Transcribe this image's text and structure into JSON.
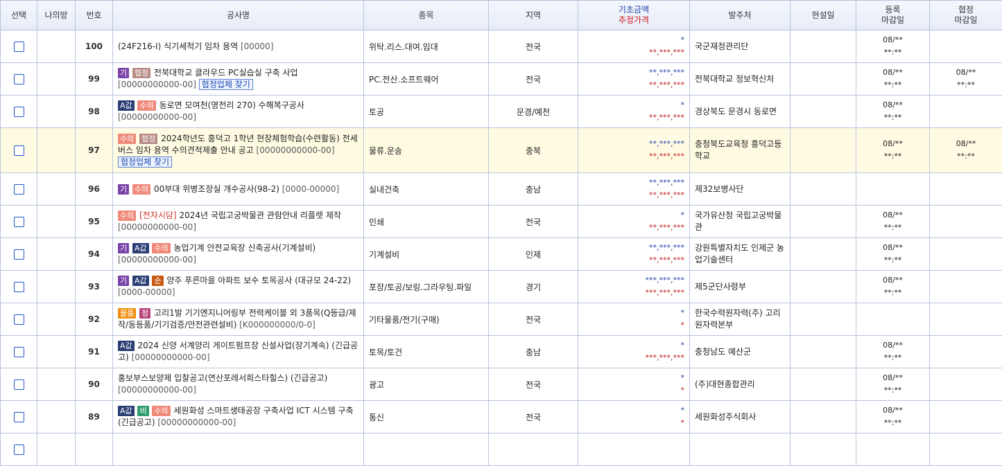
{
  "header": {
    "select": "선택",
    "mine": "나의방",
    "no": "번호",
    "title": "공사명",
    "category": "종목",
    "region": "지역",
    "price_l1": "기초금액",
    "price_l2": "추정가격",
    "owner": "발주처",
    "site_date": "현설일",
    "reg_l1": "등록",
    "reg_l2": "마감일",
    "coop_l1": "협정",
    "coop_l2": "마감일"
  },
  "rows": [
    {
      "no": "100",
      "tags": [],
      "text": "(24F216-I) 식기세척기 임차 용역",
      "code": "[00000]",
      "find": "",
      "category": "위탁.리스.대여.임대",
      "region": "전국",
      "base": "*",
      "est": "**,***,***",
      "owner": "국군재정관리단",
      "site": "",
      "reg1": "08/**",
      "reg2": "**:**",
      "coop1": "",
      "coop2": ""
    },
    {
      "no": "99",
      "tags": [
        {
          "t": "기",
          "c": "tag-gi"
        },
        {
          "t": "협정",
          "c": "tag-hj"
        }
      ],
      "text": "전북대학교 클라우드 PC실습실 구축 사업",
      "code": "[00000000000-00]",
      "find": "협정업체 찾기",
      "category": "PC.전산.소프트웨어",
      "region": "전국",
      "base": "**,***,***",
      "est": "**,***,***",
      "owner": "전북대학교 정보혁신처",
      "site": "",
      "reg1": "08/**",
      "reg2": "**:**",
      "coop1": "08/**",
      "coop2": "**:**"
    },
    {
      "no": "98",
      "tags": [
        {
          "t": "A값",
          "c": "tag-a"
        },
        {
          "t": "수의",
          "c": "tag-sui"
        }
      ],
      "text": "동로면 모여천(명전리 270) 수해복구공사",
      "code": "[00000000000-00]",
      "find": "",
      "category": "토공",
      "region": "문경/예천",
      "base": "*",
      "est": "**,***,***",
      "owner": "경상북도 문경시 동로면",
      "site": "",
      "reg1": "08/**",
      "reg2": "**:**",
      "coop1": "",
      "coop2": ""
    },
    {
      "no": "97",
      "tags": [
        {
          "t": "수의",
          "c": "tag-sui"
        },
        {
          "t": "협정",
          "c": "tag-hj"
        }
      ],
      "text": "2024학년도 흥덕고 1학년 현장체험학습(수련활동) 전세버스 임차 용역 수의견적제출 안내 공고",
      "code": "[00000000000-00]",
      "find": "협정업체 찾기",
      "category": "물류.운송",
      "region": "충북",
      "base": "**,***,***",
      "est": "**,***,***",
      "owner": "충청북도교육청 흥덕고등학교",
      "site": "",
      "reg1": "08/**",
      "reg2": "**:**",
      "coop1": "08/**",
      "coop2": "**:**"
    },
    {
      "no": "96",
      "tags": [
        {
          "t": "기",
          "c": "tag-gi"
        },
        {
          "t": "수의",
          "c": "tag-sui"
        }
      ],
      "text": "00부대 위병조장실 개수공사(98-2)",
      "code": "[0000-00000]",
      "find": "",
      "category": "실내건축",
      "region": "충남",
      "base": "**,***,***",
      "est": "**,***,***",
      "owner": "제32보병사단",
      "site": "",
      "reg1": "",
      "reg2": "",
      "coop1": "",
      "coop2": ""
    },
    {
      "no": "95",
      "tags": [
        {
          "t": "수의",
          "c": "tag-sui"
        }
      ],
      "etag": "[전자시담]",
      "text": "2024년 국립고궁박물관 관람안내 리플렛 제작",
      "code": "[00000000000-00]",
      "find": "",
      "category": "인쇄",
      "region": "전국",
      "base": "*",
      "est": "**,***,***",
      "owner": "국가유산청 국립고궁박물관",
      "site": "",
      "reg1": "08/**",
      "reg2": "**:**",
      "coop1": "",
      "coop2": ""
    },
    {
      "no": "94",
      "tags": [
        {
          "t": "기",
          "c": "tag-gi"
        },
        {
          "t": "A값",
          "c": "tag-a"
        },
        {
          "t": "수의",
          "c": "tag-sui"
        }
      ],
      "text": "농업기계 안전교육장 신축공사(기계설비)",
      "code": "[00000000000-00]",
      "find": "",
      "category": "기계설비",
      "region": "인제",
      "base": "**,***,***",
      "est": "**,***,***",
      "owner": "강원특별자치도 인제군 농업기술센터",
      "site": "",
      "reg1": "08/**",
      "reg2": "**:**",
      "coop1": "",
      "coop2": ""
    },
    {
      "no": "93",
      "tags": [
        {
          "t": "기",
          "c": "tag-gi"
        },
        {
          "t": "A값",
          "c": "tag-a"
        },
        {
          "t": "순",
          "c": "tag-sun"
        }
      ],
      "text": "양주 푸른마을 아파트 보수 토목공사 (대규모 24-22)",
      "code": "[0000-00000]",
      "find": "",
      "category": "포장/토공/보링.그라우팅.파일",
      "region": "경기",
      "base": "***,***,***",
      "est": "***,***,***",
      "owner": "제5군단사령부",
      "site": "",
      "reg1": "08/**",
      "reg2": "**:**",
      "coop1": "",
      "coop2": ""
    },
    {
      "no": "92",
      "tags": [
        {
          "t": "물품",
          "c": "tag-mul"
        },
        {
          "t": "정",
          "c": "tag-jeong"
        }
      ],
      "text": "고리1발 기기엔지니어링부 전력케이블 외 3품목(Q등급/제작/동등품/기기검증/안전관련설비)",
      "code": "[K000000000/0-0]",
      "find": "",
      "category": "기타물품/전기(구매)",
      "region": "전국",
      "base": "*",
      "est": "*",
      "owner": "한국수력원자력(주) 고리원자력본부",
      "site": "",
      "reg1": "",
      "reg2": "",
      "coop1": "",
      "coop2": ""
    },
    {
      "no": "91",
      "tags": [
        {
          "t": "A값",
          "c": "tag-a"
        }
      ],
      "text": "2024 신양 서계양리 게이트펌프장 신설사업(장기계속) (긴급공고)",
      "code": "[00000000000-00]",
      "find": "",
      "category": "토목/토건",
      "region": "충남",
      "base": "*",
      "est": "***,***,***",
      "owner": "충청남도 예산군",
      "site": "",
      "reg1": "08/**",
      "reg2": "**:**",
      "coop1": "",
      "coop2": ""
    },
    {
      "no": "90",
      "tags": [],
      "text": "홍보부스보양제 입찰공고(연산포레서희스타힐스) (긴급공고)",
      "code": "[00000000000-00]",
      "find": "",
      "category": "광고",
      "region": "전국",
      "base": "*",
      "est": "*",
      "owner": "(주)대현종합관리",
      "site": "",
      "reg1": "08/**",
      "reg2": "**:**",
      "coop1": "",
      "coop2": ""
    },
    {
      "no": "89",
      "tags": [
        {
          "t": "A값",
          "c": "tag-a"
        },
        {
          "t": "비",
          "c": "tag-bi"
        },
        {
          "t": "수의",
          "c": "tag-sui"
        }
      ],
      "text": "세원화성 스마트생태공장 구축사업 ICT 시스템 구축 (긴급공고)",
      "code": "[00000000000-00]",
      "find": "",
      "category": "통신",
      "region": "전국",
      "base": "*",
      "est": "*",
      "owner": "세원화성주식회사",
      "site": "",
      "reg1": "08/**",
      "reg2": "**:**",
      "coop1": "",
      "coop2": ""
    },
    {
      "no": "",
      "tags": [
        {
          "t": "",
          "c": "tag-mul"
        },
        {
          "t": "",
          "c": "tag-gi"
        }
      ],
      "text": "",
      "code": "",
      "find": "",
      "category": "",
      "region": "",
      "base": "",
      "est": "",
      "owner": "",
      "site": "",
      "reg1": "",
      "reg2": "",
      "coop1": "",
      "coop2": ""
    }
  ]
}
